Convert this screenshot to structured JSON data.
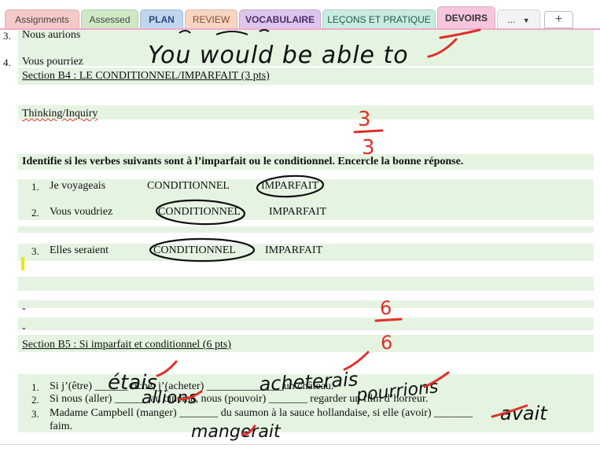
{
  "tabs": [
    {
      "label": "Assignments",
      "bg": "#f6c9c9",
      "color": "#444444"
    },
    {
      "label": "Assessed",
      "bg": "#cfe9c4",
      "color": "#444444"
    },
    {
      "label": "PLAN",
      "bg": "#bfd6ee",
      "color": "#2b4a7a"
    },
    {
      "label": "REVIEW",
      "bg": "#f7d5c2",
      "color": "#8a4b2b"
    },
    {
      "label": "VOCABULAIRE",
      "bg": "#dcc6ec",
      "color": "#4b2b6b"
    },
    {
      "label": "LEÇONS ET PRATIQUE",
      "bg": "#c8ecdf",
      "color": "#225a46"
    },
    {
      "label": "DEVOIRS",
      "bg": "#f7c6de",
      "color": "#333333",
      "active": true
    },
    {
      "label": "...",
      "bg": "#f3f3f3",
      "color": "#333333"
    }
  ],
  "add_tab_label": "+",
  "content": {
    "item3_number": "3.",
    "item3_text": "Nous aurions",
    "item4_number": "4.",
    "item4_text": "Vous pourriez",
    "section_b4_title": "Section B4 : LE CONDITIONNEL/IMPARFAIT (3 pts)",
    "thinking_label": "Thinking/Inquiry",
    "instructions": "Identifie si les verbes suivants sont à l’imparfait ou le conditionnel.  Encercle la bonne réponse.",
    "b4_items": [
      {
        "number": "1.",
        "verb": "Je voyageais",
        "option_a": "CONDITIONNEL",
        "option_b": "IMPARFAIT"
      },
      {
        "number": "2.",
        "verb": "Vous voudriez",
        "option_a": "CONDITIONNEL",
        "option_b": "IMPARFAIT"
      },
      {
        "number": "3.",
        "verb": "Elles seraient",
        "option_a": "CONDITIONNEL",
        "option_b": "IMPARFAIT"
      }
    ],
    "dash1": "-",
    "dash2": "-",
    "section_b5_title": "Section B5 : Si imparfait et conditionnel  (6 pts)",
    "b5_items": [
      {
        "number": "1.",
        "part1": "Si j’(être) ",
        "blank1": "______",
        "part2": " riche, j’(acheter) ",
        "blank2": "______________",
        "part3": "un château."
      },
      {
        "number": "2.",
        "part1": "Si nous (aller) ",
        "blank1": "______",
        "part2": " au cinéma, nous (pouvoir) ",
        "blank2": "_______",
        "part3": " regarder un film d’horreur."
      },
      {
        "number": "3.",
        "part1": "Madame Campbell (manger) ",
        "blank1": "_______",
        "part2": " du saumon à la sauce hollandaise, si elle (avoir) ",
        "blank2": "_______",
        "part3": "faim."
      }
    ]
  },
  "handwriting": {
    "q4_answer": "You would be able to",
    "b4_score_numerator": "3",
    "b4_score_denominator": "3",
    "b5_score_numerator": "6",
    "b5_score_denominator": "6",
    "ans_etais": "étais",
    "ans_acheterais": "acheterais",
    "ans_allions": "allions",
    "ans_pourrions": "pourrions",
    "ans_avait": "avait",
    "ans_mangerait": "mangerait"
  },
  "colors": {
    "accent_tab_underline": "#f2a8cf",
    "row_band": "#e4f4e1",
    "ink_black": "#111111",
    "ink_red": "#e0302a",
    "cursor_highlight": "#f3e600"
  }
}
